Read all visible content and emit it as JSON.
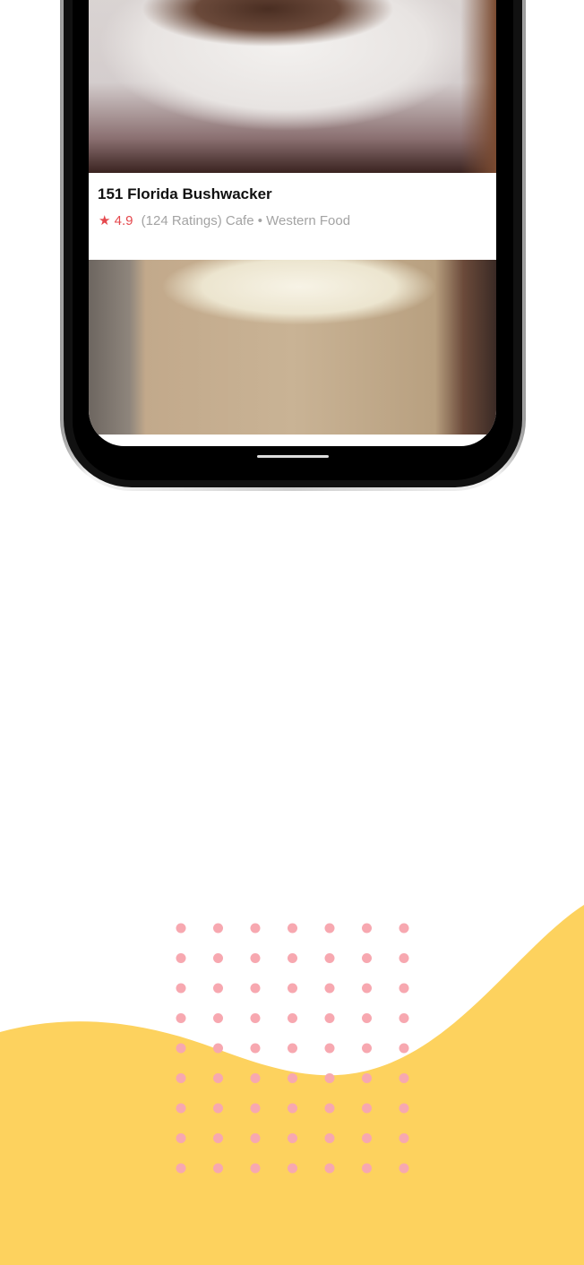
{
  "card": {
    "title": "151 Florida Bushwacker",
    "star_icon": "★",
    "rating": "4.9",
    "details": "(124 Ratings) Cafe • Western Food"
  },
  "colors": {
    "accent": "#e5484d",
    "wave": "#fdd25e",
    "dots": "#f7a8b0"
  }
}
